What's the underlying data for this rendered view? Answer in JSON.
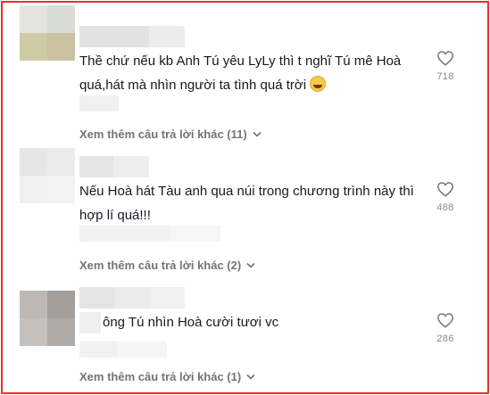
{
  "comments": [
    {
      "text": "Thề chứ nếu kb Anh Tú yêu LyLy thì t nghĩ Tú mê Hoà quá,hát mà nhìn người ta tình quá trời",
      "has_emoji": true,
      "emoji_icon": "laughing-emoji-icon",
      "likes": "718",
      "more_replies": "Xem thêm câu trả lời khác (11)"
    },
    {
      "text": "Nếu Hoà hát Tàu anh qua núi trong chương trình này thì hợp lí quá!!!",
      "likes": "488",
      "more_replies": "Xem thêm câu trả lời khác (2)"
    },
    {
      "text": "ông Tú nhìn Hoà cười tươi vc",
      "likes": "286",
      "more_replies": "Xem thêm câu trả lời khác (1)"
    }
  ],
  "icons": {
    "like": "heart-outline-icon",
    "expand": "chevron-down-icon"
  },
  "colors": {
    "frame_border": "#e8302f",
    "text": "#161823",
    "muted": "#73747b"
  }
}
